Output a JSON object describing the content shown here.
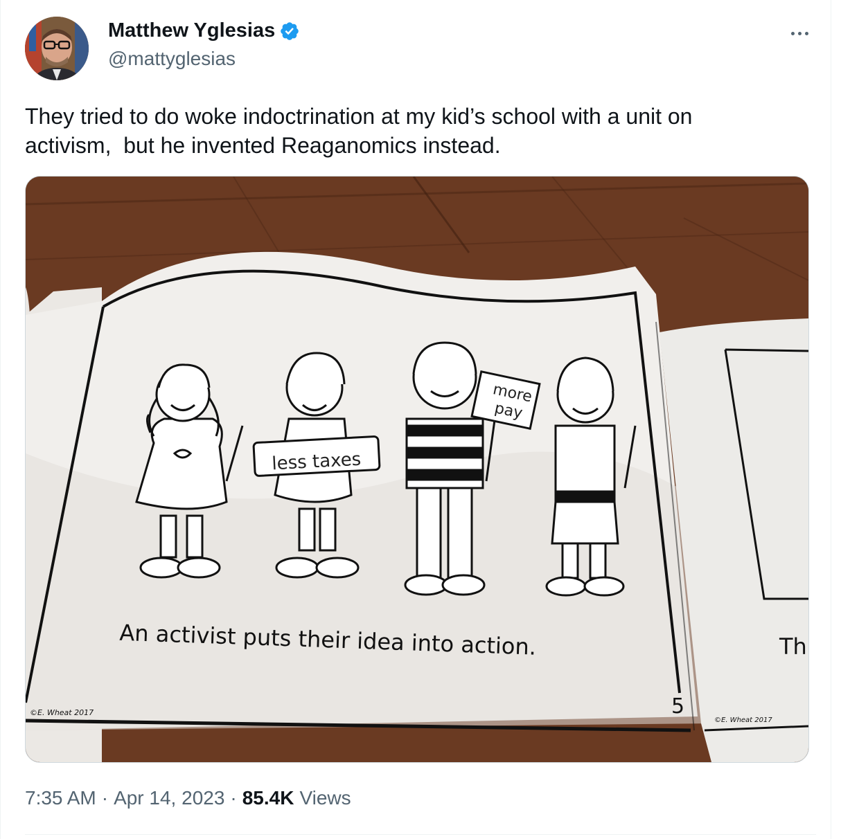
{
  "author": {
    "display_name": "Matthew Yglesias",
    "handle": "@mattyglesias",
    "verified": true,
    "avatar_icon": "profile-photo"
  },
  "tweet": {
    "text": "They tried to do woke indoctrination at my kid’s school with a unit on\nactivism,  but he invented Reaganomics instead."
  },
  "media": {
    "caption": "An activist puts their idea into action.",
    "page_number": "5",
    "copyright_left": "©E. Wheat 2017",
    "copyright_right": "©E. Wheat 2017",
    "next_page_text": "Th",
    "sign_left": "less taxes",
    "sign_right_line1": "more",
    "sign_right_line2": "pay"
  },
  "meta": {
    "time": "7:35 AM",
    "date": "Apr 14, 2023",
    "views_count": "85.4K",
    "views_label": "Views",
    "separator": "·"
  },
  "colors": {
    "verified": "#1d9bf0",
    "secondary_text": "#536471",
    "primary_text": "#0f1419",
    "wood": "#6a3a22"
  }
}
